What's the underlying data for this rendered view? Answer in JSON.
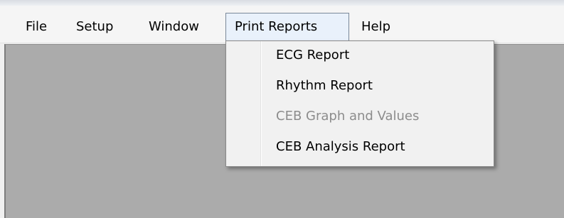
{
  "menubar": {
    "items": [
      {
        "label": "File"
      },
      {
        "label": "Setup"
      },
      {
        "label": "Window"
      },
      {
        "label": "Print Reports"
      },
      {
        "label": "Help"
      }
    ]
  },
  "print_reports_menu": {
    "items": [
      {
        "label": "ECG Report",
        "enabled": true
      },
      {
        "label": "Rhythm Report",
        "enabled": true
      },
      {
        "label": "CEB Graph and Values",
        "enabled": false
      },
      {
        "label": "CEB Analysis Report",
        "enabled": true
      }
    ]
  }
}
